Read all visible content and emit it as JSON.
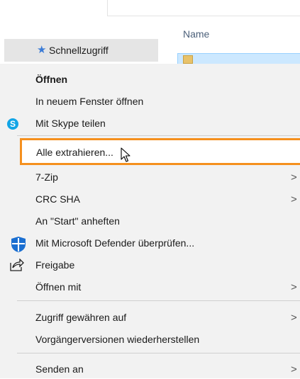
{
  "header": {
    "column_name": "Name"
  },
  "nav": {
    "quick_access_label": "Schnellzugriff"
  },
  "menu": {
    "open": "Öffnen",
    "open_new_window": "In neuem Fenster öffnen",
    "skype_share": "Mit Skype teilen",
    "extract_all": "Alle extrahieren...",
    "seven_zip": "7-Zip",
    "crc_sha": "CRC SHA",
    "pin_start": "An \"Start\" anheften",
    "defender": "Mit Microsoft Defender überprüfen...",
    "share": "Freigabe",
    "open_with": "Öffnen mit",
    "grant_access": "Zugriff gewähren auf",
    "restore_versions": "Vorgängerversionen wiederherstellen",
    "send_to": "Senden an",
    "chevron": ">"
  },
  "colors": {
    "highlight": "#f5901e",
    "menu_bg": "#f2f2f2",
    "selection": "#cce8ff"
  },
  "icons": [
    "skype-icon",
    "defender-shield-icon",
    "share-icon",
    "star-icon",
    "zip-folder-icon",
    "mouse-cursor-icon"
  ]
}
